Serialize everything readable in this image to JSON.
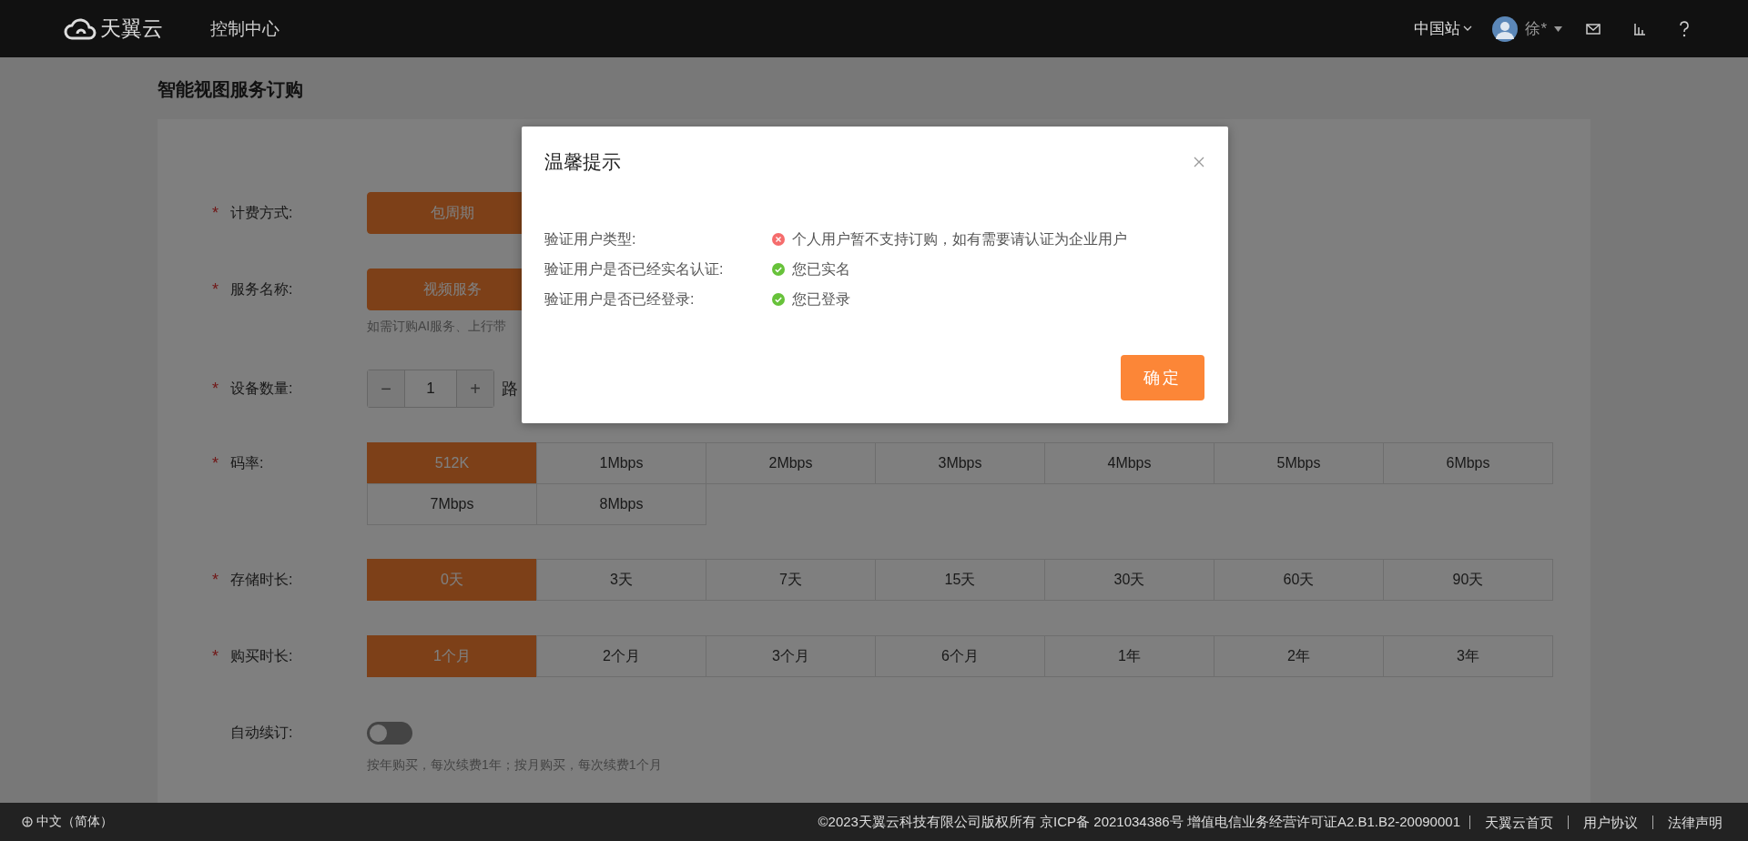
{
  "header": {
    "logo_text": "天翼云",
    "nav": "控制中心",
    "region": "中国站",
    "user": "徐*"
  },
  "page_title": "智能视图服务订购",
  "form": {
    "rows": [
      {
        "kind": "options",
        "label": "计费方式:",
        "required_mark": "*",
        "options": [
          {
            "label": "包周期",
            "selected": true
          }
        ]
      },
      {
        "kind": "options",
        "label": "服务名称:",
        "required_mark": "*",
        "options": [
          {
            "label": "视频服务",
            "selected": true
          }
        ],
        "hint": "如需订购AI服务、上行带"
      },
      {
        "kind": "stepper",
        "label": "设备数量:",
        "required_mark": "*",
        "value": "1",
        "minus": "−",
        "plus": "+",
        "unit": "路"
      },
      {
        "kind": "options",
        "label": "码率:",
        "required_mark": "*",
        "options": [
          {
            "label": "512K",
            "selected": true
          },
          {
            "label": "1Mbps",
            "selected": false
          },
          {
            "label": "2Mbps",
            "selected": false
          },
          {
            "label": "3Mbps",
            "selected": false
          },
          {
            "label": "4Mbps",
            "selected": false
          },
          {
            "label": "5Mbps",
            "selected": false
          },
          {
            "label": "6Mbps",
            "selected": false
          },
          {
            "label": "7Mbps",
            "selected": false
          },
          {
            "label": "8Mbps",
            "selected": false
          }
        ]
      },
      {
        "kind": "options",
        "label": "存储时长:",
        "required_mark": "*",
        "options": [
          {
            "label": "0天",
            "selected": true
          },
          {
            "label": "3天",
            "selected": false
          },
          {
            "label": "7天",
            "selected": false
          },
          {
            "label": "15天",
            "selected": false
          },
          {
            "label": "30天",
            "selected": false
          },
          {
            "label": "60天",
            "selected": false
          },
          {
            "label": "90天",
            "selected": false
          }
        ]
      },
      {
        "kind": "options",
        "label": "购买时长:",
        "required_mark": "*",
        "options": [
          {
            "label": "1个月",
            "selected": true
          },
          {
            "label": "2个月",
            "selected": false
          },
          {
            "label": "3个月",
            "selected": false
          },
          {
            "label": "6个月",
            "selected": false
          },
          {
            "label": "1年",
            "selected": false
          },
          {
            "label": "2年",
            "selected": false
          },
          {
            "label": "3年",
            "selected": false
          }
        ]
      },
      {
        "kind": "toggle",
        "label": "自动续订:",
        "on": false,
        "hint": "按年购买，每次续费1年；按月购买，每次续费1个月"
      }
    ]
  },
  "dialog": {
    "title": "温馨提示",
    "checks": [
      {
        "label": "验证用户类型:",
        "result": "个人用户暂不支持订购，如有需要请认证为企业用户",
        "passed": false
      },
      {
        "label": "验证用户是否已经实名认证:",
        "result": "您已实名",
        "passed": true
      },
      {
        "label": "验证用户是否已经登录:",
        "result": "您已登录",
        "passed": true
      }
    ],
    "confirm": "确定"
  },
  "footer": {
    "language": "中文（简体）",
    "copyright": "©2023天翼云科技有限公司版权所有 京ICP备 2021034386号 增值电信业务经营许可证A2.B1.B2-20090001",
    "links": [
      "天翼云首页",
      "用户协议",
      "法律声明"
    ]
  }
}
